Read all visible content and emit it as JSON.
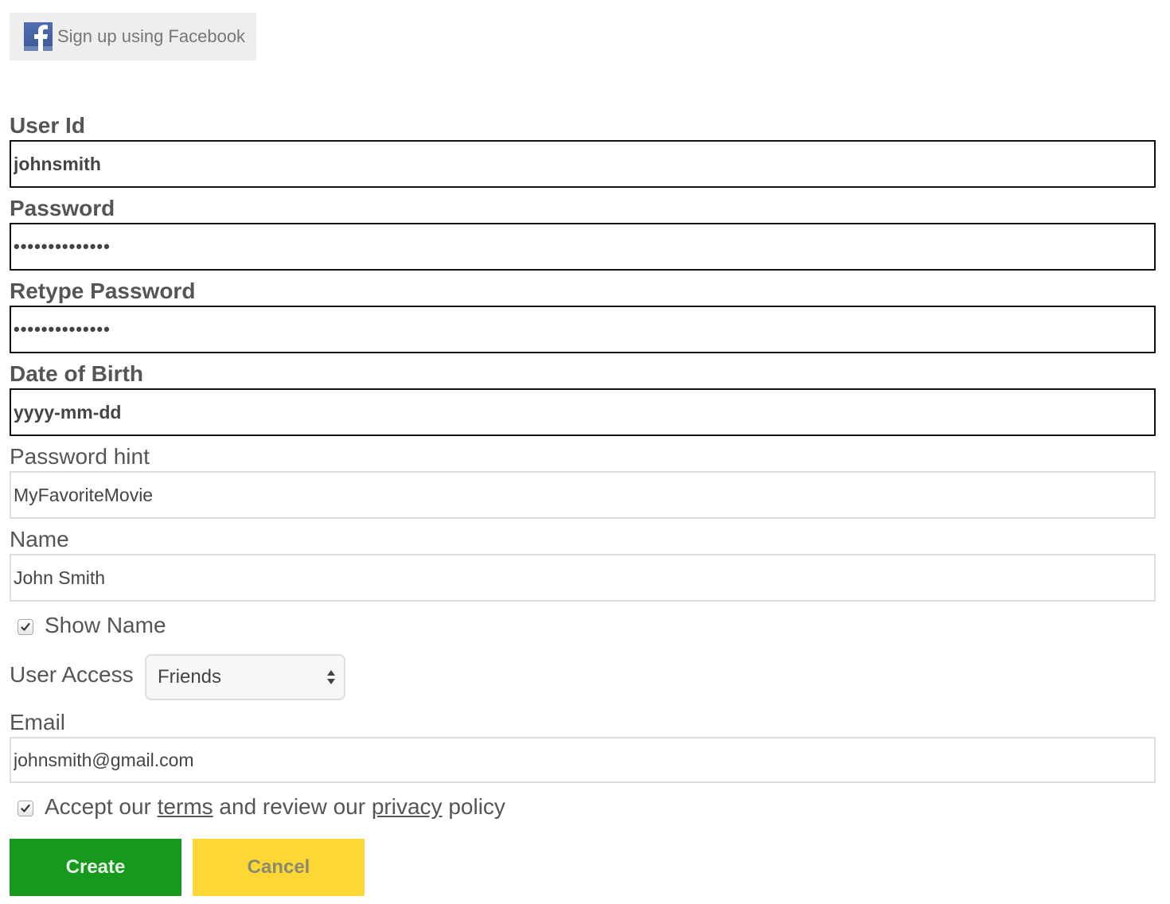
{
  "facebook": {
    "label": "Sign up using Facebook",
    "icon": "facebook-icon",
    "brand_color": "#3b5998"
  },
  "form": {
    "user_id": {
      "label": "User Id",
      "value": "johnsmith"
    },
    "password": {
      "label": "Password",
      "value": "••••••••••••••"
    },
    "retype_password": {
      "label": "Retype Password",
      "value": "••••••••••••••"
    },
    "dob": {
      "label": "Date of Birth",
      "value": "yyyy-mm-dd"
    },
    "password_hint": {
      "label": "Password hint",
      "value": "MyFavoriteMovie"
    },
    "name": {
      "label": "Name",
      "value": "John Smith"
    },
    "show_name": {
      "label": "Show Name",
      "checked": true
    },
    "user_access": {
      "label": "User Access",
      "selected": "Friends"
    },
    "email": {
      "label": "Email",
      "value": "johnsmith@gmail.com"
    },
    "accept": {
      "checked": true,
      "prefix": "Accept our ",
      "terms_link": "terms",
      "middle": " and review our ",
      "privacy_link": "privacy",
      "suffix": " policy"
    }
  },
  "buttons": {
    "create": {
      "label": "Create",
      "color": "#17991d"
    },
    "cancel": {
      "label": "Cancel",
      "color": "#fdd835"
    }
  }
}
